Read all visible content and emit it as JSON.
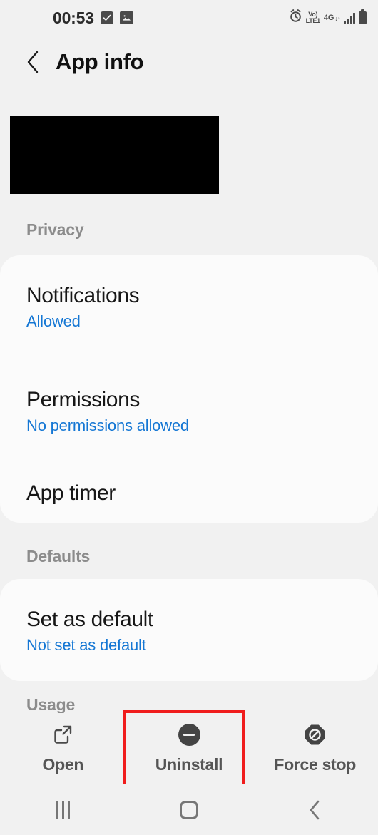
{
  "status_bar": {
    "clock": "00:53",
    "left_icons": [
      "checkbox-checked-icon",
      "image-icon"
    ],
    "right_icons": [
      "alarm-icon",
      "volte-icon",
      "network-4g-icon",
      "signal-bars-icon",
      "battery-icon"
    ],
    "volte_top": "Vo)",
    "volte_bottom": "LTE1",
    "network_type": "4G",
    "network_arrows": "↓↑"
  },
  "header": {
    "back_icon": "chevron-left-icon",
    "title": "App info"
  },
  "app_header": {
    "redacted": true
  },
  "sections": [
    {
      "label": "Privacy",
      "rows": [
        {
          "title": "Notifications",
          "subtitle": "Allowed"
        },
        {
          "title": "Permissions",
          "subtitle": "No permissions allowed"
        },
        {
          "title": "App timer",
          "subtitle": ""
        }
      ]
    },
    {
      "label": "Defaults",
      "rows": [
        {
          "title": "Set as default",
          "subtitle": "Not set as default"
        }
      ]
    },
    {
      "label": "Usage",
      "rows": []
    }
  ],
  "action_bar": {
    "actions": [
      {
        "label": "Open",
        "icon": "external-link-icon",
        "highlighted": false
      },
      {
        "label": "Uninstall",
        "icon": "minus-circle-icon",
        "highlighted": true
      },
      {
        "label": "Force stop",
        "icon": "block-octagon-icon",
        "highlighted": false
      }
    ]
  },
  "nav_bar": {
    "recents_icon": "recents-icon",
    "home_icon": "home-icon",
    "back_icon": "nav-back-icon"
  },
  "colors": {
    "background": "#f1f1f1",
    "card": "#fbfbfb",
    "accent_link": "#1577d4",
    "section_label": "#8c8c8c",
    "title_text": "#171717",
    "highlight": "#f01c1c",
    "icon_gray": "#4a4a4a",
    "nav_gray": "#767676"
  }
}
